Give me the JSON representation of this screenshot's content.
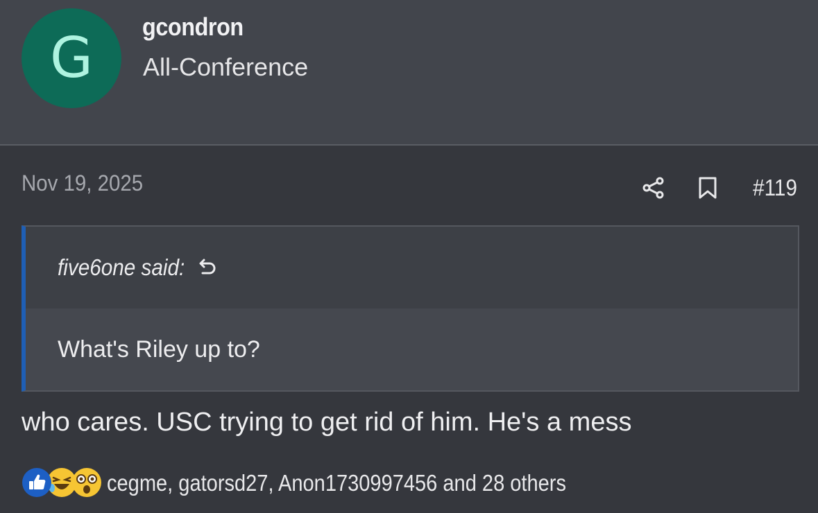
{
  "user": {
    "avatar_letter": "G",
    "avatar_color": "#0d6b57",
    "username": "gcondron",
    "title": "All-Conference"
  },
  "post": {
    "date": "Nov 19, 2025",
    "number": "#119",
    "actions": [
      "share-icon",
      "bookmark-icon"
    ],
    "quote": {
      "author_label": "five6one said:",
      "text": "What's Riley up to?",
      "accent_color": "#1f5fb5"
    },
    "message": "who cares. USC trying to get rid of him. He's a mess",
    "reactions": {
      "icons": [
        "like-icon",
        "haha-icon",
        "wow-icon"
      ],
      "summary": "cegme, gatorsd27, Anon1730997456 and 28 others"
    }
  }
}
